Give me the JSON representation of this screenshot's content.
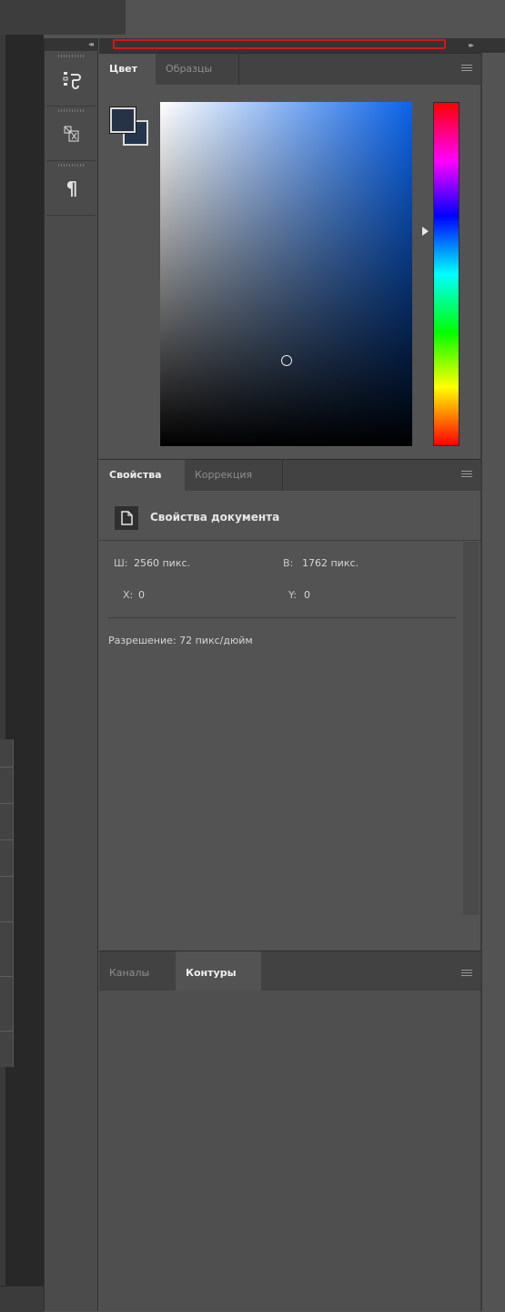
{
  "dock": {
    "collapse_glyph": "◂◂",
    "buttons": [
      {
        "name": "history-icon",
        "glyph": "⁝↺"
      },
      {
        "name": "character-icon",
        "glyph": "⧉"
      },
      {
        "name": "paragraph-icon",
        "glyph": "¶"
      }
    ]
  },
  "panels": {
    "expand_glyph": "▸▸"
  },
  "color_panel": {
    "tabs": [
      {
        "label": "Цвет",
        "active": true
      },
      {
        "label": "Образцы",
        "active": false
      }
    ],
    "foreground": "#263246",
    "background": "#24354e",
    "hue_color": "#0b63e8"
  },
  "properties_panel": {
    "tabs": [
      {
        "label": "Свойства",
        "active": true
      },
      {
        "label": "Коррекция",
        "active": false
      }
    ],
    "title": "Свойства документа",
    "width_label": "Ш:",
    "width_value": "2560 пикс.",
    "height_label": "В:",
    "height_value": "1762 пикс.",
    "x_label": "X:",
    "x_value": "0",
    "y_label": "Y:",
    "y_value": "0",
    "resolution": "Разрешение: 72 пикс/дюйм"
  },
  "paths_panel": {
    "tabs": [
      {
        "label": "Каналы",
        "active": false
      },
      {
        "label": "Контуры",
        "active": true
      }
    ]
  }
}
